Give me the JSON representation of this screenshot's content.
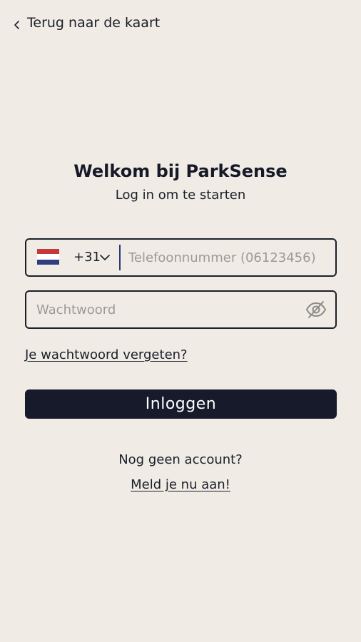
{
  "header": {
    "back_label": "Terug naar de kaart"
  },
  "welcome": {
    "title": "Welkom bij ParkSense",
    "subtitle": "Log in om te starten"
  },
  "phone": {
    "country_flag": "netherlands-flag",
    "country_code": "+31",
    "placeholder": "Telefoonnummer (06123456)",
    "value": ""
  },
  "password": {
    "placeholder": "Wachtwoord",
    "value": "",
    "toggle_icon": "eye-slash-icon"
  },
  "forgot_password_label": "Je wachtwoord vergeten?",
  "login_button_label": "Inloggen",
  "signup": {
    "prompt": "Nog geen account?",
    "link_label": "Meld je nu aan!"
  },
  "colors": {
    "background": "#f0ece5",
    "primary": "#161a2b",
    "text": "#1b1f2a",
    "placeholder": "#9b9a98",
    "divider_accent": "#2a3b78"
  }
}
